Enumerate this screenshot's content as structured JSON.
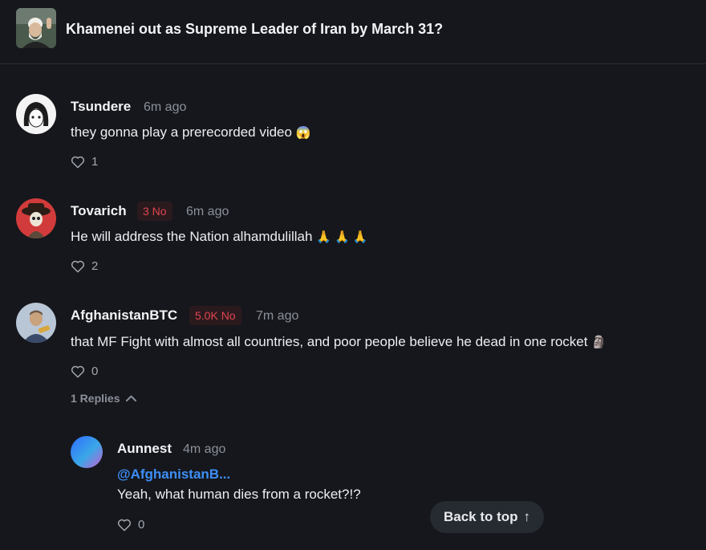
{
  "market": {
    "title": "Khamenei out as Supreme Leader of Iran by March 31?"
  },
  "comments": [
    {
      "username": "Tsundere",
      "position": "",
      "time": "6m ago",
      "text": "they gonna play a prerecorded video",
      "emoji": "😱",
      "likes": "1"
    },
    {
      "username": "Tovarich",
      "position": "3 No",
      "time": "6m ago",
      "text": "He will address the Nation alhamdulillah",
      "emoji": "🙏 🙏 🙏",
      "likes": "2"
    },
    {
      "username": "AfghanistanBTC",
      "position": "5.0K No",
      "time": "7m ago",
      "text": "that MF Fight with almost all countries, and poor people believe he dead in one rocket",
      "emoji": "🗿",
      "likes": "0",
      "replies_label": "1 Replies"
    }
  ],
  "reply": {
    "username": "Aunnest",
    "time": "4m ago",
    "mention": "@AfghanistanB...",
    "text": "Yeah, what human dies from a rocket?!?",
    "likes": "0"
  },
  "back_to_top": {
    "label": "Back to top",
    "arrow": "↑"
  },
  "colors": {
    "background": "#15171c",
    "no_position": "#e0454d",
    "mention": "#3d8ef7"
  }
}
